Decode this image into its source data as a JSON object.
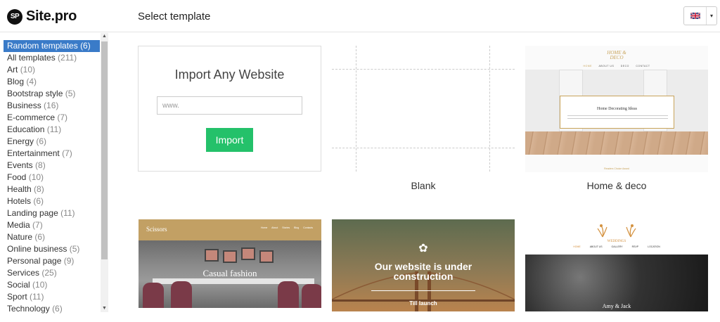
{
  "header": {
    "logo_badge": "SP",
    "logo_text": "Site.pro",
    "title": "Select template",
    "language_flag": "uk-flag-icon",
    "language_caret": "▾"
  },
  "sidebar": {
    "categories": [
      {
        "label": "Random templates",
        "count": "(6)",
        "active": true
      },
      {
        "label": "All templates",
        "count": "(211)"
      },
      {
        "label": "Art",
        "count": "(10)"
      },
      {
        "label": "Blog",
        "count": "(4)"
      },
      {
        "label": "Bootstrap style",
        "count": "(5)"
      },
      {
        "label": "Business",
        "count": "(16)"
      },
      {
        "label": "E-commerce",
        "count": "(7)"
      },
      {
        "label": "Education",
        "count": "(11)"
      },
      {
        "label": "Energy",
        "count": "(6)"
      },
      {
        "label": "Entertainment",
        "count": "(7)"
      },
      {
        "label": "Events",
        "count": "(8)"
      },
      {
        "label": "Food",
        "count": "(10)"
      },
      {
        "label": "Health",
        "count": "(8)"
      },
      {
        "label": "Hotels",
        "count": "(6)"
      },
      {
        "label": "Landing page",
        "count": "(11)"
      },
      {
        "label": "Media",
        "count": "(7)"
      },
      {
        "label": "Nature",
        "count": "(6)"
      },
      {
        "label": "Online business",
        "count": "(5)"
      },
      {
        "label": "Personal page",
        "count": "(9)"
      },
      {
        "label": "Services",
        "count": "(25)"
      },
      {
        "label": "Social",
        "count": "(10)"
      },
      {
        "label": "Sport",
        "count": "(11)"
      },
      {
        "label": "Technology",
        "count": "(6)"
      }
    ]
  },
  "import_card": {
    "title": "Import Any Website",
    "input_placeholder": "www.",
    "button_label": "Import"
  },
  "templates": {
    "blank": {
      "label": "Blank"
    },
    "home_deco": {
      "label": "Home & deco",
      "logo_line1": "HOME &",
      "logo_line2": "DECO",
      "nav": [
        "HOME",
        "ABOUT US",
        "DECO",
        "CONTACT"
      ],
      "box_title": "Home Decorating Ideas",
      "footer": "Readers Choice Award"
    },
    "scissors": {
      "logo": "Scissors",
      "nav": [
        "Home",
        "About",
        "Stories",
        "Blog",
        "Contacts"
      ],
      "hero_title": "Casual fashion"
    },
    "construction": {
      "gear_icon": "✿",
      "title_line1": "Our website is under",
      "title_line2": "construction",
      "subtitle": "Till launch"
    },
    "weddings": {
      "logo": "WEDDINGS",
      "nav": [
        "HOME",
        "ABOUT US",
        "GALLERY",
        "RSVP",
        "LOCATION"
      ],
      "names": "Amy & Jack"
    }
  }
}
